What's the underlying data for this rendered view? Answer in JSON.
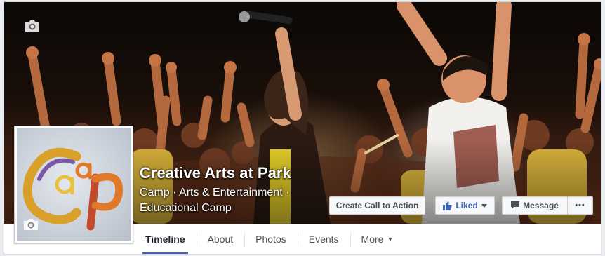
{
  "page": {
    "name": "Creative Arts at Park",
    "category": "Camp · Arts & Entertainment · Educational Camp"
  },
  "profile": {
    "logo_text": "CaaP"
  },
  "actions": {
    "cta_label": "Create Call to Action",
    "liked_label": "Liked",
    "message_label": "Message",
    "more_label": "•••"
  },
  "tabs": [
    {
      "label": "Timeline",
      "active": true
    },
    {
      "label": "About",
      "active": false
    },
    {
      "label": "Photos",
      "active": false
    },
    {
      "label": "Events",
      "active": false
    },
    {
      "label": "More",
      "active": false
    }
  ],
  "colors": {
    "accent": "#4267b2",
    "button_bg": "#f6f7f9",
    "page_bg": "#e9ebee"
  },
  "icons": {
    "cover_camera": "camera-icon",
    "profile_camera": "camera-icon",
    "liked": "thumbs-up-icon",
    "liked_caret": "caret-down-icon",
    "message": "message-icon",
    "more_caret": "caret-down-icon"
  }
}
